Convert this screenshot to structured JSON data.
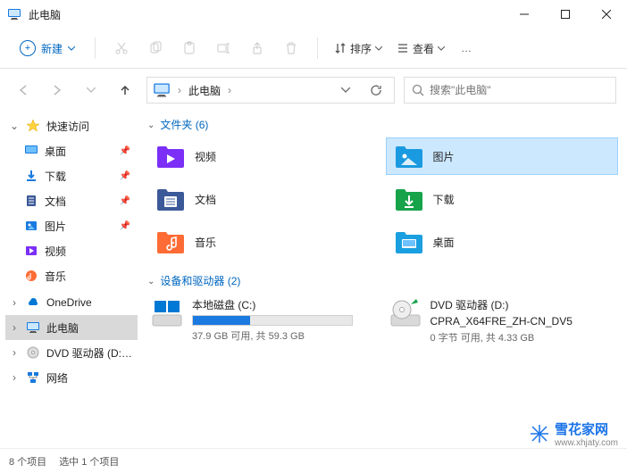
{
  "titlebar": {
    "title": "此电脑"
  },
  "toolbar": {
    "new_label": "新建",
    "sort_label": "排序",
    "view_label": "查看"
  },
  "breadcrumb": {
    "location": "此电脑"
  },
  "search": {
    "placeholder": "搜索\"此电脑\""
  },
  "sidebar": {
    "quick_access": "快速访问",
    "pinned": [
      {
        "label": "桌面"
      },
      {
        "label": "下载"
      },
      {
        "label": "文档"
      },
      {
        "label": "图片"
      }
    ],
    "recent": [
      {
        "label": "视频"
      },
      {
        "label": "音乐"
      }
    ],
    "onedrive": "OneDrive",
    "this_pc": "此电脑",
    "dvd": "DVD 驱动器 (D:) CP",
    "network": "网络"
  },
  "content": {
    "folders_header": "文件夹 (6)",
    "folders": [
      {
        "label": "视频"
      },
      {
        "label": "图片",
        "selected": true
      },
      {
        "label": "文档"
      },
      {
        "label": "下载"
      },
      {
        "label": "音乐"
      },
      {
        "label": "桌面"
      }
    ],
    "drives_header": "设备和驱动器 (2)",
    "drives": [
      {
        "name": "本地磁盘 (C:)",
        "sub": "37.9 GB 可用, 共 59.3 GB",
        "used_pct": 36
      },
      {
        "name": "DVD 驱动器 (D:)",
        "sub2": "CPRA_X64FRE_ZH-CN_DV5",
        "sub": "0 字节 可用, 共 4.33 GB"
      }
    ]
  },
  "statusbar": {
    "count": "8 个项目",
    "selection": "选中 1 个项目"
  },
  "watermark": {
    "text": "雪花家网",
    "url": "www.xhjaty.com"
  }
}
